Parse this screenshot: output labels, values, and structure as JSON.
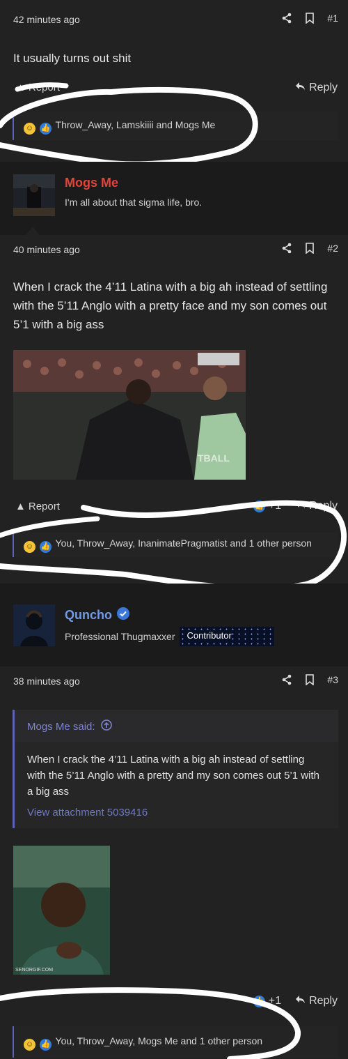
{
  "posts": [
    {
      "time": "42 minutes ago",
      "number": "#1",
      "body": "It usually turns out shit",
      "report_label": "Report",
      "reply_label": "Reply",
      "reactions": "Throw_Away, Lamskiiii and Mogs Me"
    },
    {
      "time": "40 minutes ago",
      "number": "#2",
      "body": "When I crack the 4’11 Latina with a big ah instead of settling with the 5’11 Anglo with a pretty face and my son comes out 5’1 with a big ass",
      "report_label": "Report",
      "plus_label": "+1",
      "reply_label": "Reply",
      "reactions": "You, Throw_Away, InanimatePragmatist and 1 other person"
    },
    {
      "time": "38 minutes ago",
      "number": "#3",
      "quote_author": "Mogs Me said:",
      "quote_body": "When I crack the 4’11 Latina with a big ah instead of settling with the 5’11 Anglo with a pretty and my son comes out 5’1 with a big ass",
      "quote_link": "View attachment 5039416",
      "gif_watermark": "SENORGIF.COM",
      "plus_label": "+1",
      "reply_label": "Reply",
      "reactions": "You, Throw_Away, Mogs Me and 1 other person"
    }
  ],
  "authors": [
    {
      "name": "Mogs Me",
      "title": "I'm all about that sigma life, bro.",
      "name_color": "#e2443a"
    },
    {
      "name": "Quncho",
      "title": "Professional Thugmaxxer",
      "badge": "Contributor",
      "name_color": "#6f9be8"
    }
  ],
  "image2_text": "TBALL",
  "icons": [
    "share-icon",
    "bookmark-icon",
    "reply-icon",
    "report-icon",
    "like-icon",
    "laugh-icon",
    "verified-icon",
    "arrow-up-icon"
  ],
  "colors": {
    "accent": "#5b63b3",
    "link": "#6f78c3",
    "mogs_red": "#e2443a",
    "quncho_blue": "#6f9be8"
  }
}
